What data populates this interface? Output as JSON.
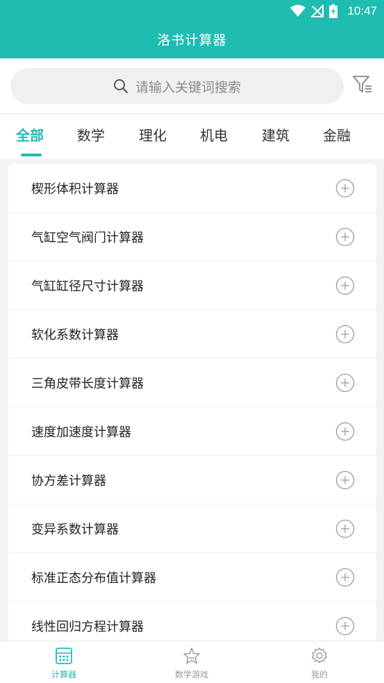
{
  "status": {
    "time": "10:47"
  },
  "app": {
    "title": "洛书计算器"
  },
  "search": {
    "placeholder": "请输入关键词搜索"
  },
  "tabs": [
    {
      "label": "全部",
      "active": true
    },
    {
      "label": "数学",
      "active": false
    },
    {
      "label": "理化",
      "active": false
    },
    {
      "label": "机电",
      "active": false
    },
    {
      "label": "建筑",
      "active": false
    },
    {
      "label": "金融",
      "active": false
    }
  ],
  "calculators": [
    {
      "label": "楔形体积计算器"
    },
    {
      "label": "气缸空气阀门计算器"
    },
    {
      "label": "气缸缸径尺寸计算器"
    },
    {
      "label": "软化系数计算器"
    },
    {
      "label": "三角皮带长度计算器"
    },
    {
      "label": "速度加速度计算器"
    },
    {
      "label": "协方差计算器"
    },
    {
      "label": "变异系数计算器"
    },
    {
      "label": "标准正态分布值计算器"
    },
    {
      "label": "线性回归方程计算器"
    }
  ],
  "bottom_nav": [
    {
      "label": "计算器",
      "icon": "calculator-icon",
      "active": true
    },
    {
      "label": "数学游戏",
      "icon": "star-icon",
      "active": false
    },
    {
      "label": "我的",
      "icon": "gear-icon",
      "active": false
    }
  ],
  "colors": {
    "accent": "#1fbcb2",
    "background": "#f3f3f3",
    "icon_gray": "#9a9a9a"
  }
}
